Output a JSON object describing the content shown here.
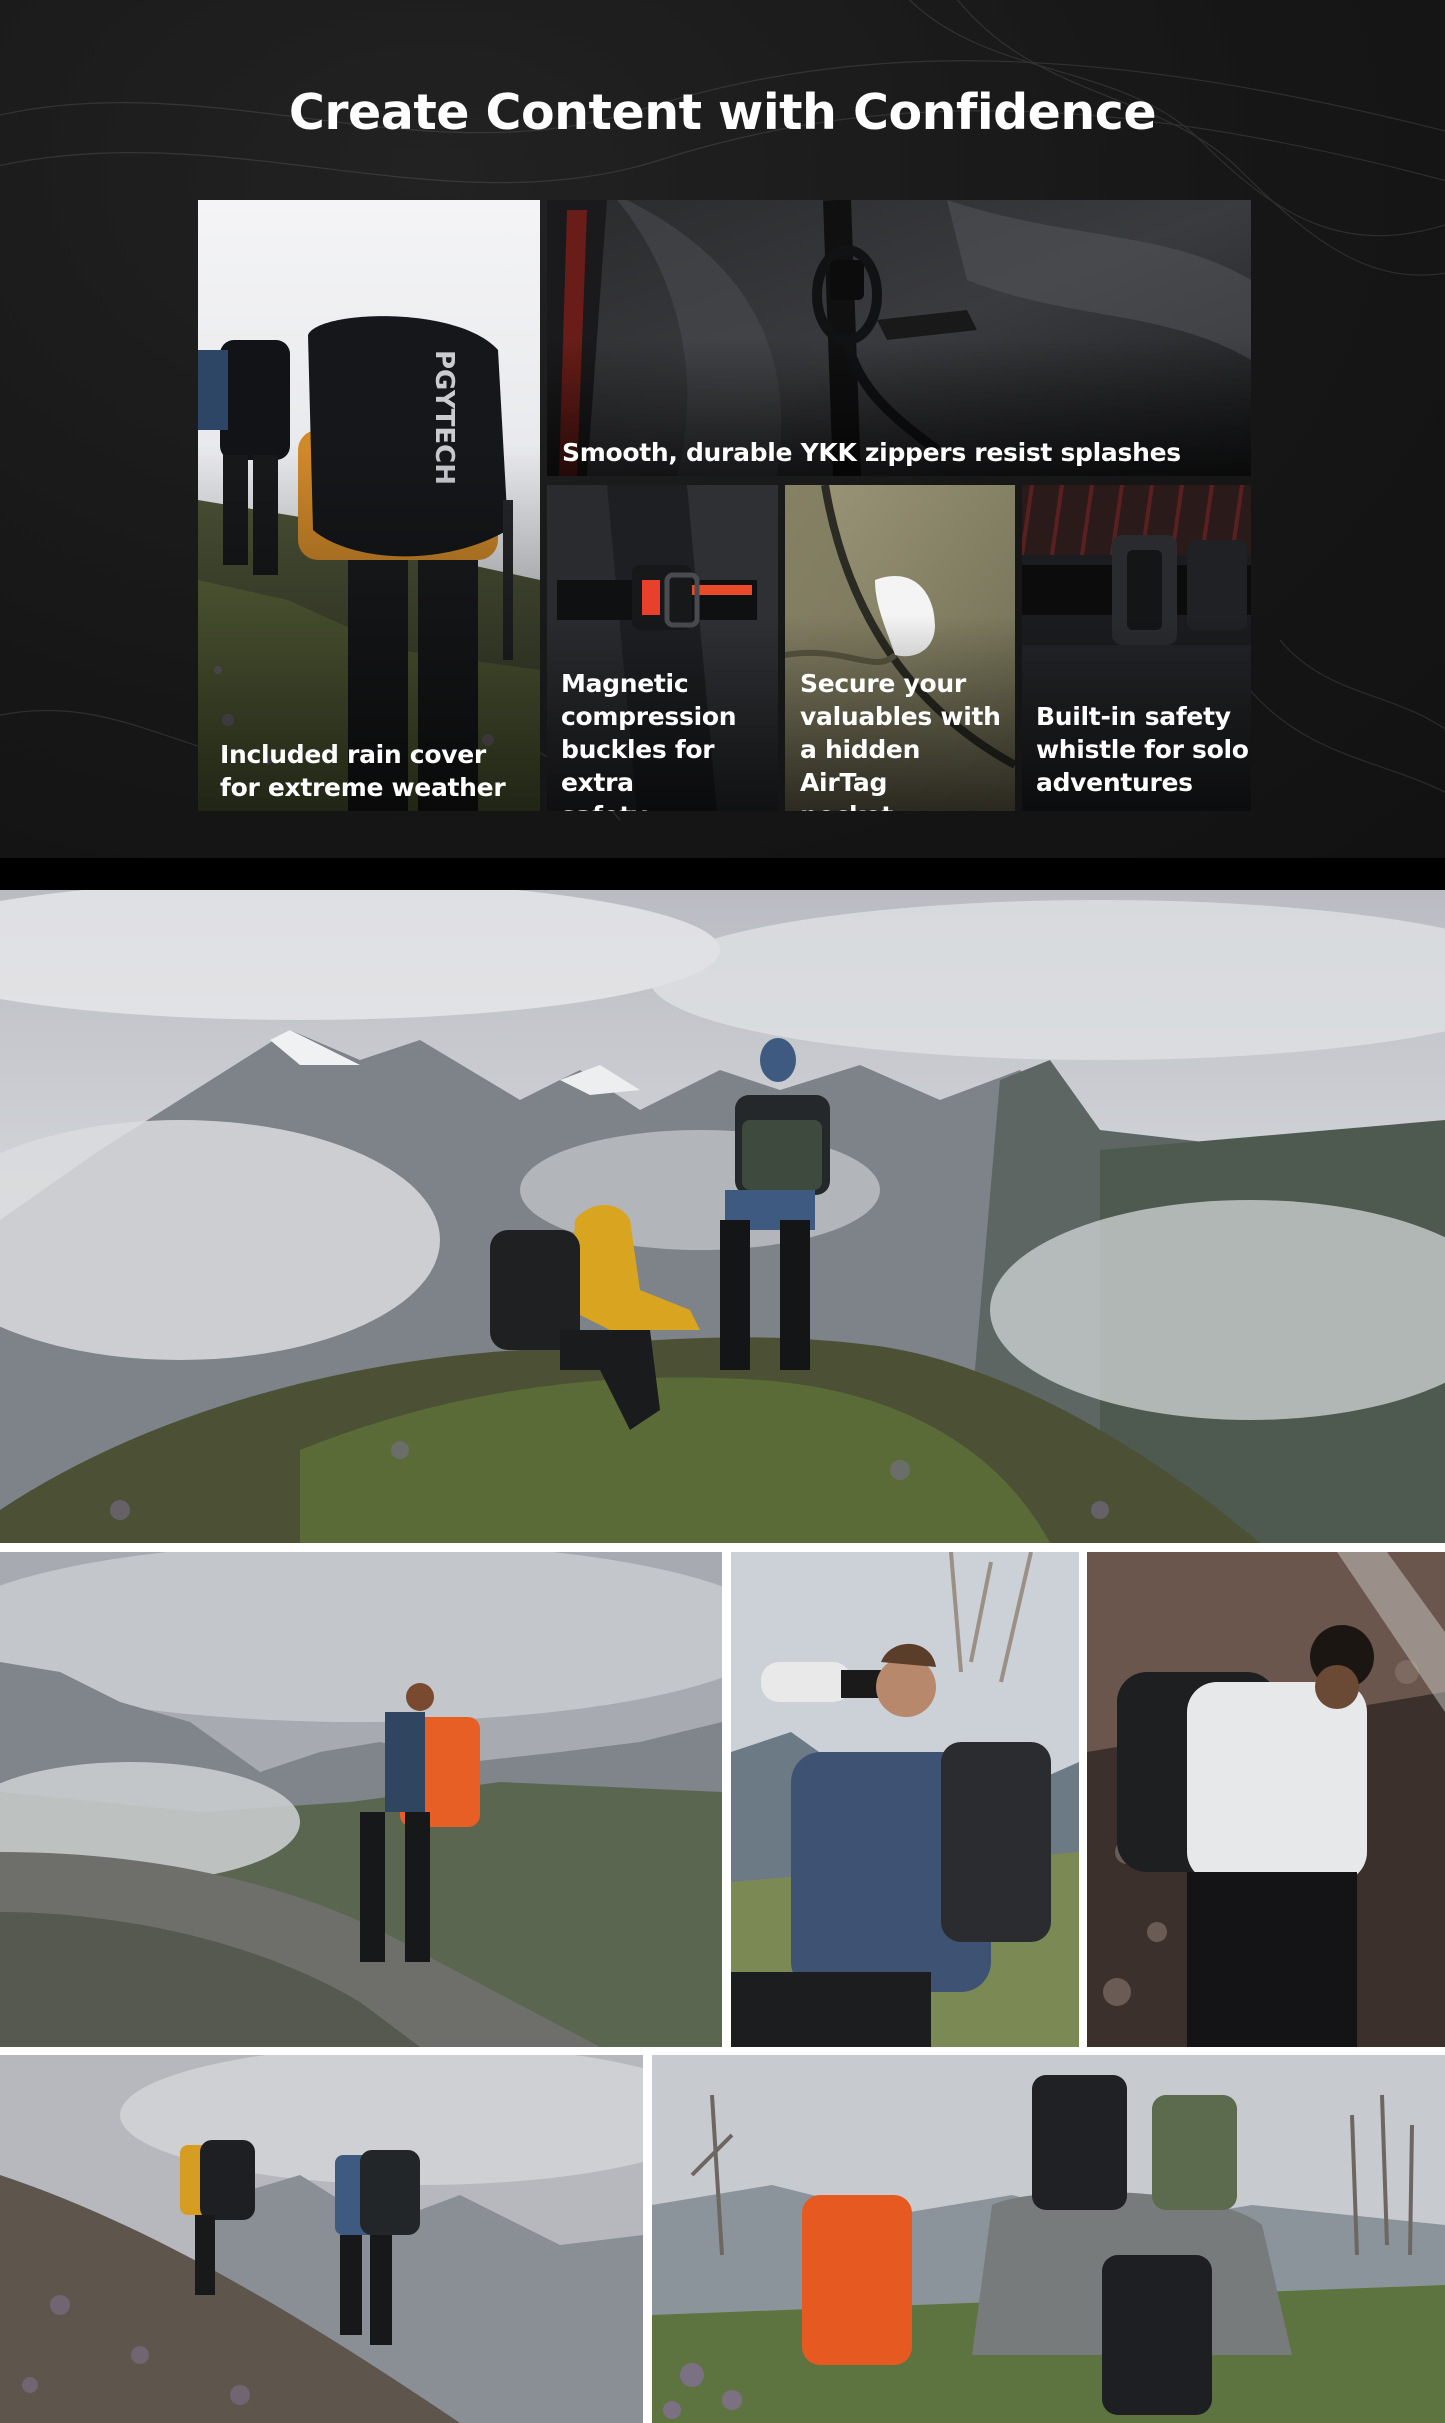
{
  "section_heading": "Create Content with Confidence",
  "features": [
    {
      "id": "rain-cover",
      "caption_lines": [
        "Included rain cover",
        "for extreme weather"
      ]
    },
    {
      "id": "ykk-zippers",
      "caption_lines": [
        "Smooth, durable YKK zippers resist splashes"
      ]
    },
    {
      "id": "magnetic-buckles",
      "caption_lines": [
        "Magnetic",
        "compression",
        "buckles for extra",
        "safety"
      ]
    },
    {
      "id": "airtag-pocket",
      "caption_lines": [
        "Secure your",
        "valuables with",
        "a hidden AirTag",
        "pocket"
      ]
    },
    {
      "id": "safety-whistle",
      "caption_lines": [
        "Built-in safety",
        "whistle for solo",
        "adventures"
      ]
    }
  ],
  "brand_mark": "PGYTECH",
  "colors": {
    "section_bg": "#161616",
    "heading": "#ffffff",
    "caption": "#ffffff",
    "band": "#000000",
    "accent_orange": "#e8622a",
    "accent_yellow": "#e0a526"
  },
  "gallery": [
    {
      "id": "hero-mountain-ridge"
    },
    {
      "id": "hiker-orange-pack"
    },
    {
      "id": "photographer-telephoto"
    },
    {
      "id": "hiker-white-jacket"
    },
    {
      "id": "two-hikers-slope"
    },
    {
      "id": "backpack-lineup"
    }
  ]
}
